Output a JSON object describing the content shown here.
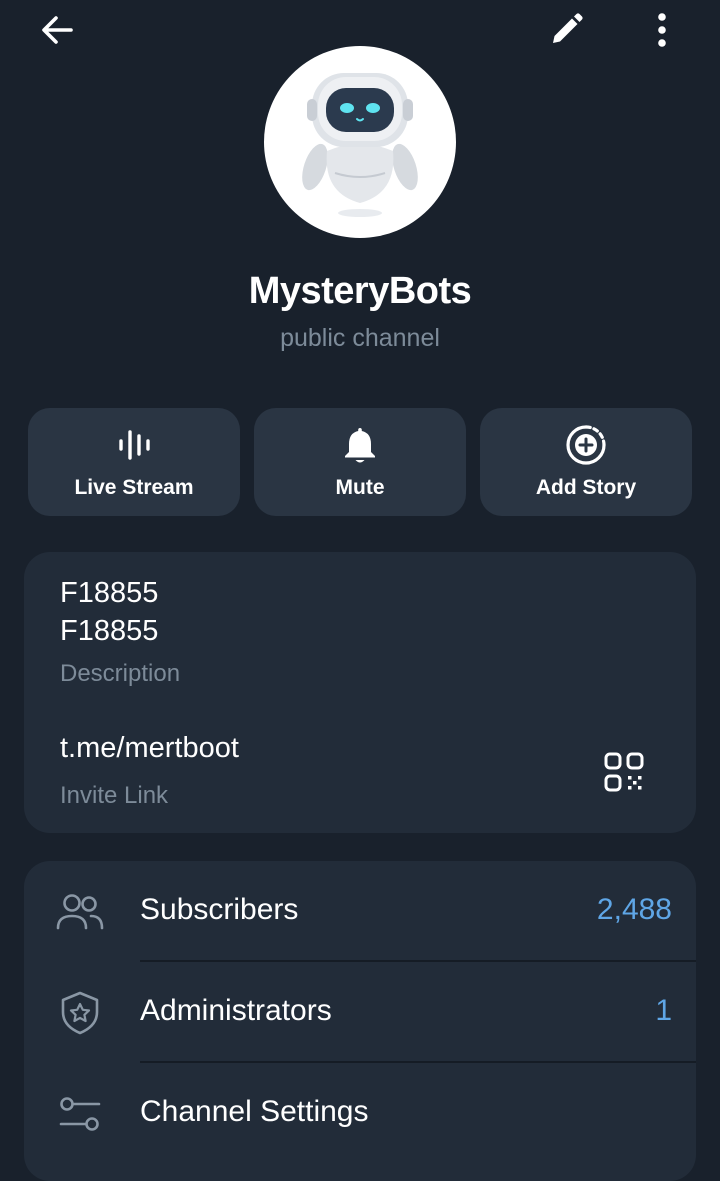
{
  "header": {
    "back_icon": "arrow-left-icon",
    "edit_icon": "pencil-icon",
    "more_icon": "more-vertical-icon"
  },
  "profile": {
    "avatar_icon": "robot-avatar-icon",
    "name": "MysteryBots",
    "type": "public channel"
  },
  "actions": [
    {
      "label": "Live Stream",
      "icon": "live-stream-icon"
    },
    {
      "label": "Mute",
      "icon": "bell-icon"
    },
    {
      "label": "Add Story",
      "icon": "add-story-icon"
    }
  ],
  "info": {
    "description": "F18855\nF18855",
    "description_label": "Description",
    "link": "t.me/mertboot",
    "link_label": "Invite Link",
    "qr_icon": "qr-code-icon"
  },
  "list": [
    {
      "label": "Subscribers",
      "value": "2,488",
      "icon": "users-icon"
    },
    {
      "label": "Administrators",
      "value": "1",
      "icon": "shield-star-icon"
    },
    {
      "label": "Channel Settings",
      "value": "",
      "icon": "settings-sliders-icon"
    }
  ],
  "colors": {
    "background": "#19212c",
    "card": "#222c39",
    "button": "#2a3543",
    "accent": "#5fa6e6",
    "secondary_text": "#7d8b99"
  }
}
